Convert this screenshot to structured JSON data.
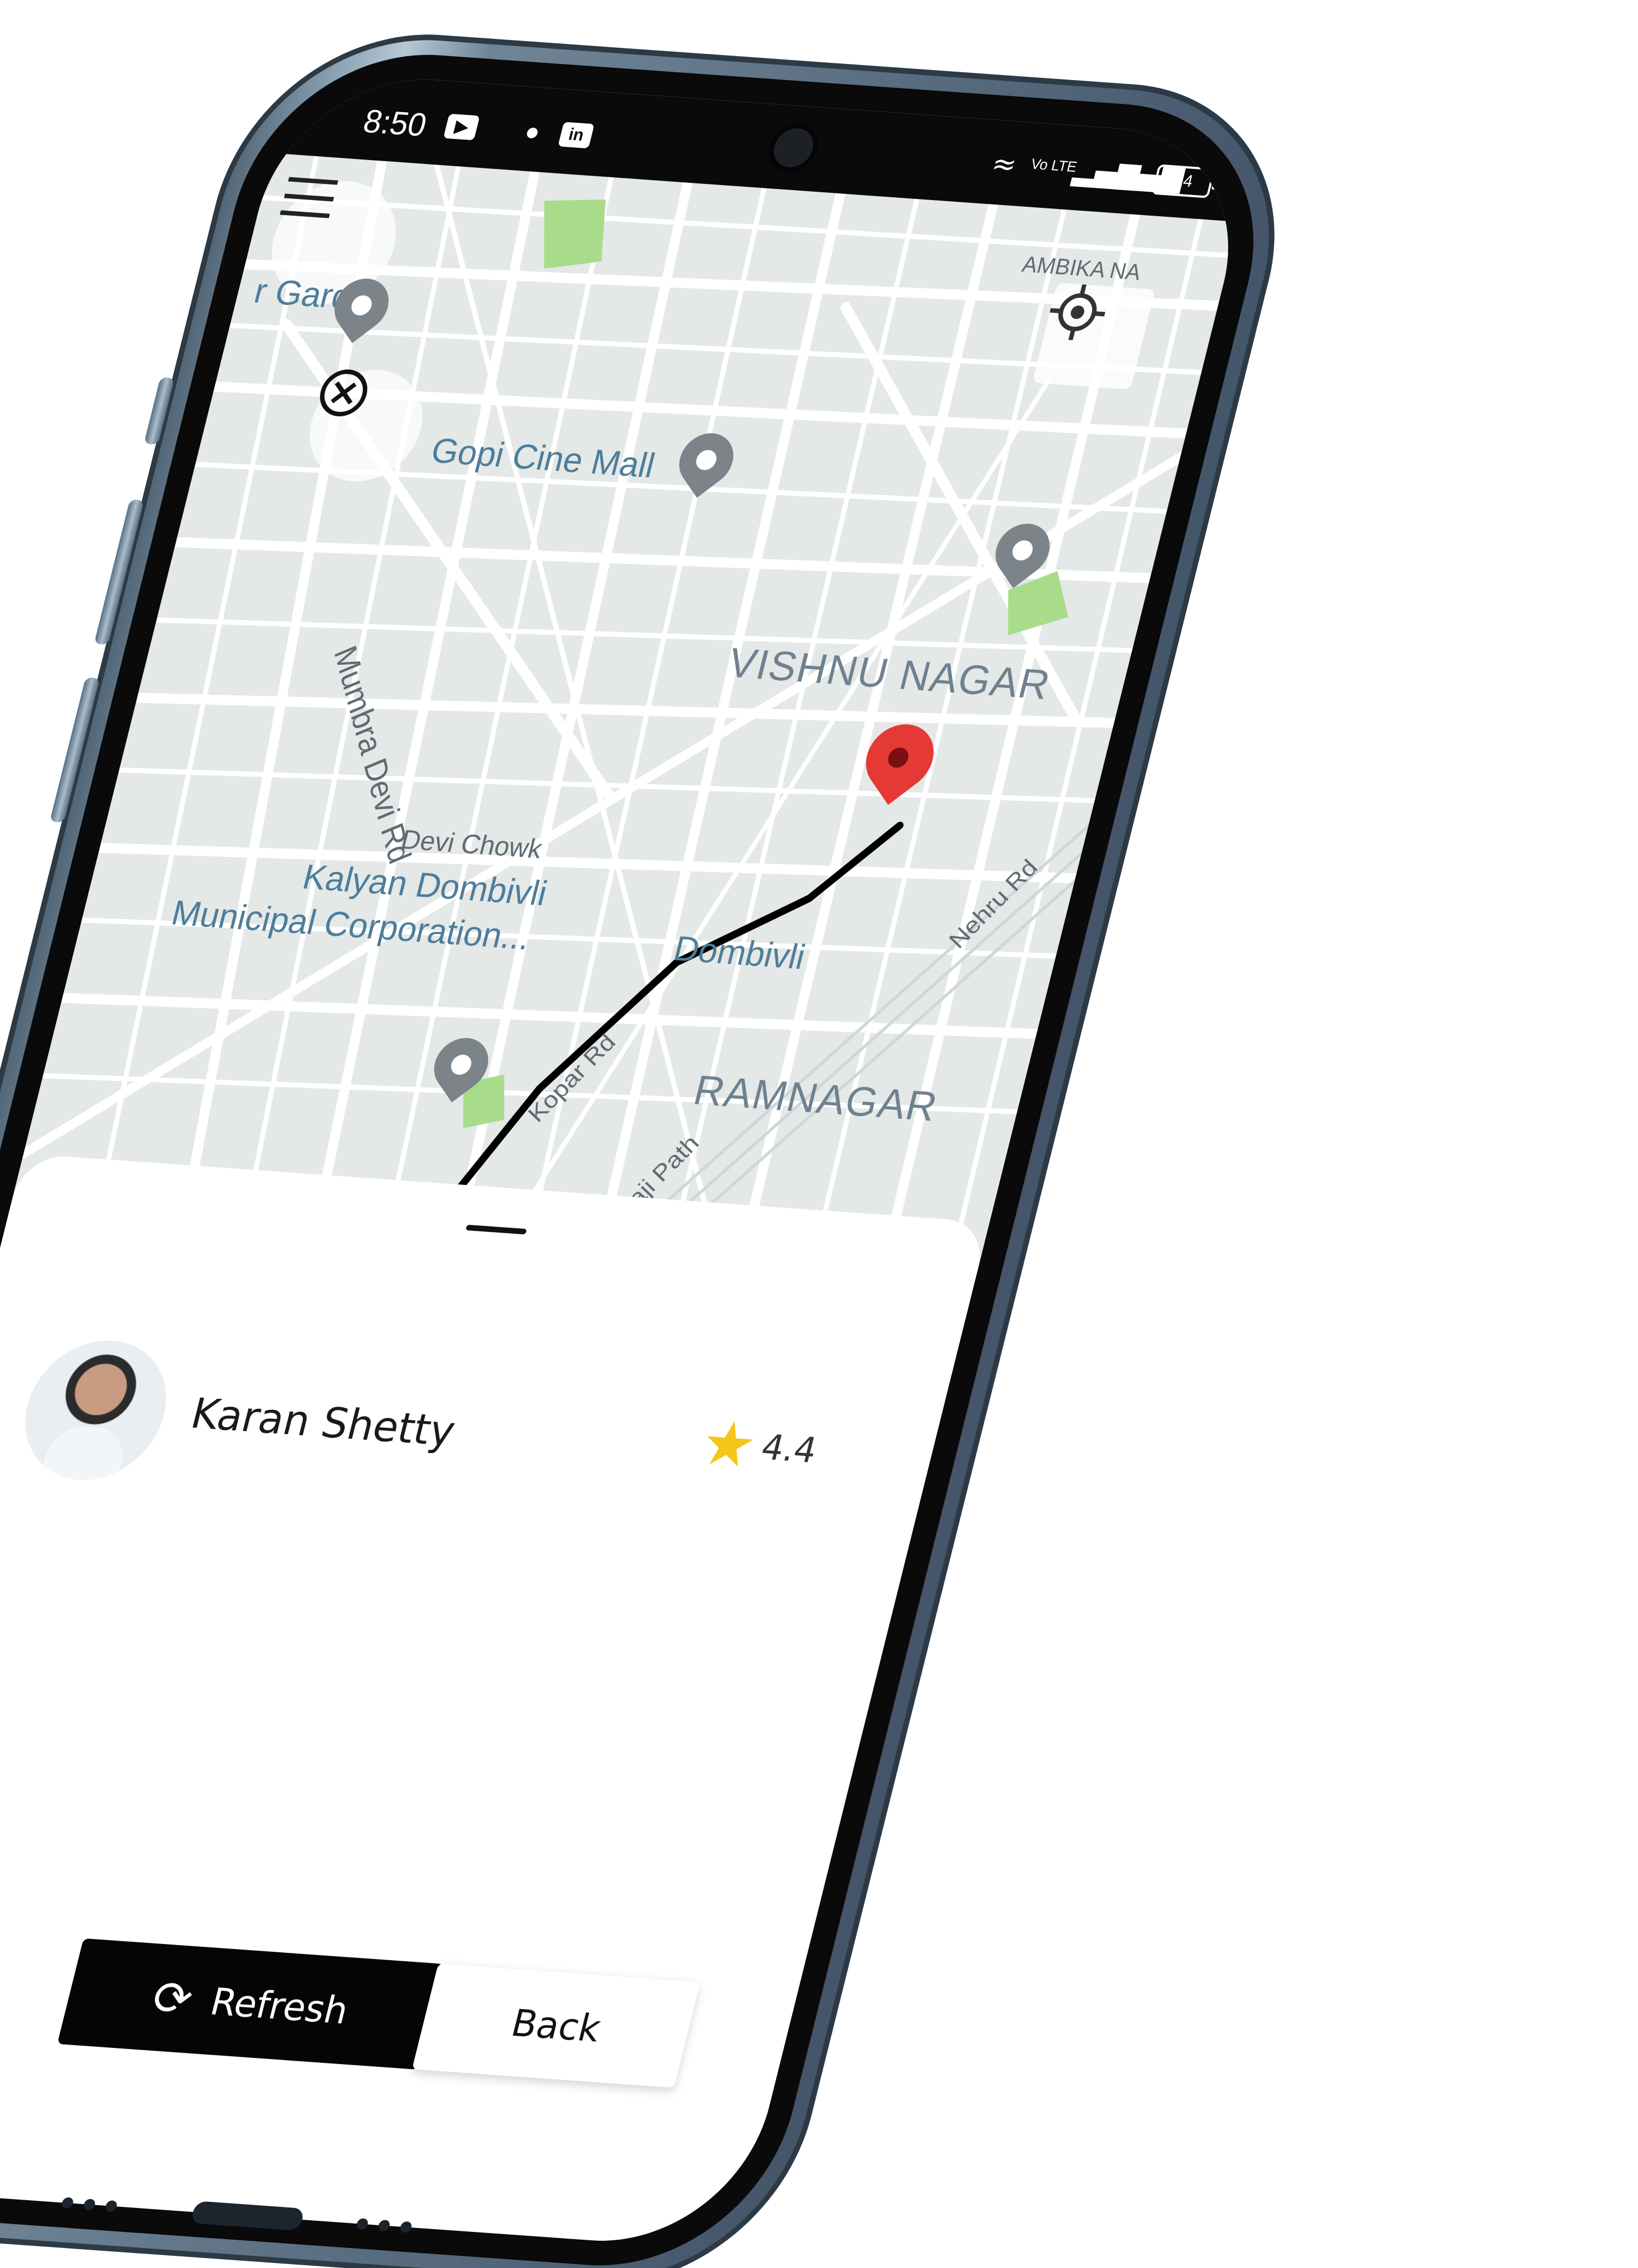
{
  "status_bar": {
    "time": "8:50",
    "network_label": "Vo LTE",
    "battery": "14"
  },
  "map": {
    "labels": {
      "garden": "r Garden",
      "ambika": "AMBIKA NA",
      "cinema": "Gopi Cine Mall",
      "vishnu": "VISHNU NAGAR",
      "mumbra": "Mumbra Devi Rd",
      "devi_chowk": "Devi Chowk",
      "kdmc_1": "Kalyan Dombivli",
      "kdmc_2": "Municipal Corporation...",
      "dombivli": "Dombivli",
      "nehru": "Nehru Rd",
      "ramnagar": "RAMNAGAR",
      "kopar": "Kopar Rd",
      "rajaji": "Rajaji Path"
    },
    "route_color": "#000000",
    "destination_pin_color": "#e53935",
    "origin_pin_color": "#2ecc2e"
  },
  "driver": {
    "name": "Karan Shetty",
    "rating": "4.4"
  },
  "actions": {
    "refresh_label": "Refresh",
    "back_label": "Back"
  }
}
